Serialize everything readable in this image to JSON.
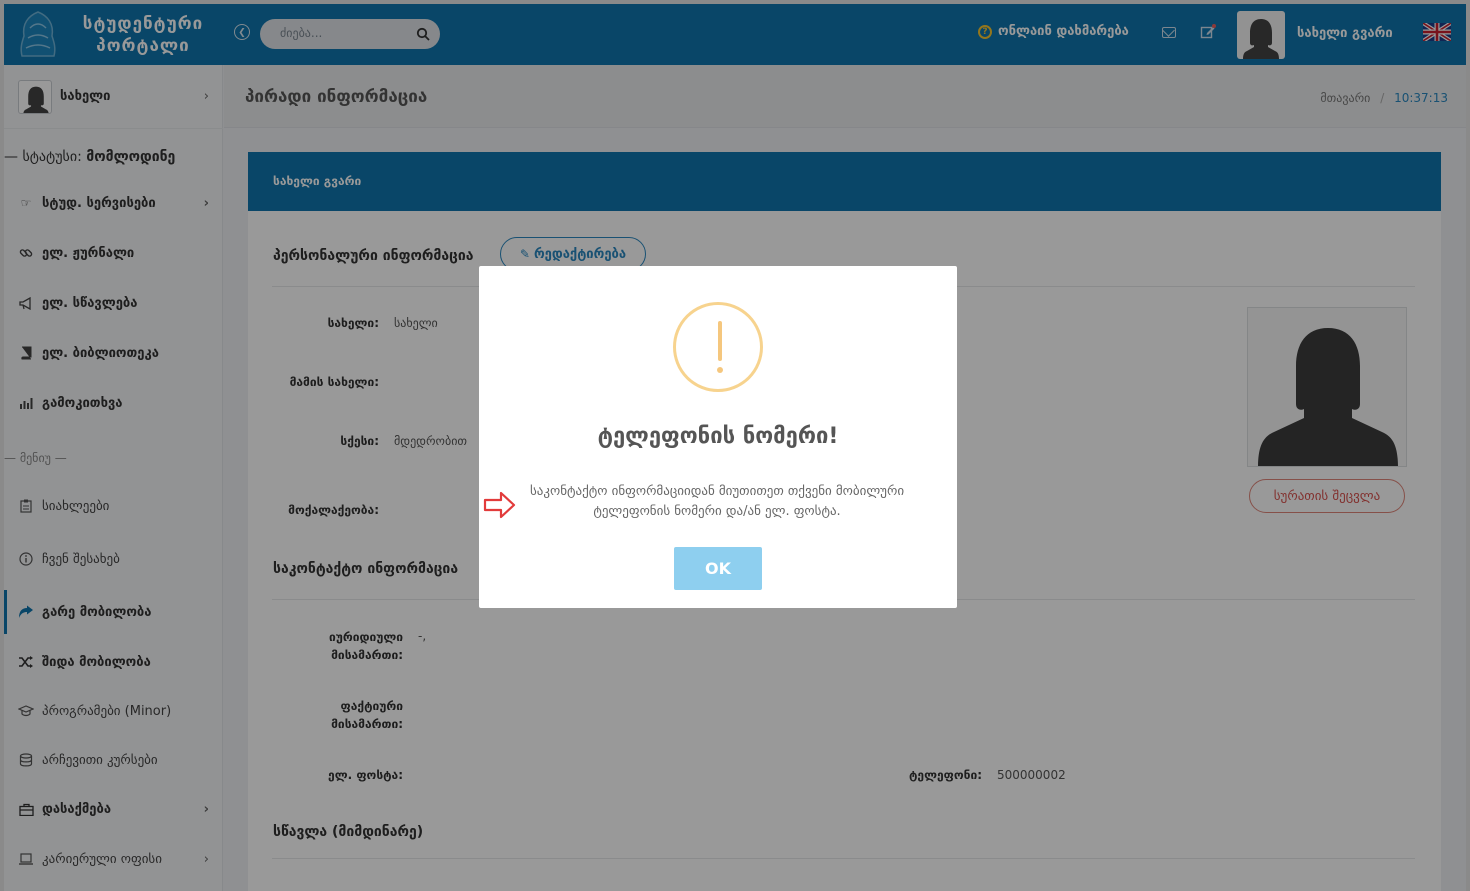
{
  "header": {
    "logo_line1": "სტუდენტური",
    "logo_line2": "პორტალი",
    "search_placeholder": "ძიება...",
    "help_label": "ონლაინ დახმარება",
    "user_name": "სახელი გვარი",
    "colors": {
      "topbar": "#0f76ad",
      "help_icon": "#f5c531"
    }
  },
  "sidebar": {
    "profile_name": "სახელი",
    "status_label": "— სტატუსი:",
    "status_value": "მომლოდინე",
    "menu_separator": "— მენიუ —",
    "items_top": [
      {
        "label": "სტუდ. სერვისები",
        "icon": "hand-point-icon",
        "has_chevron": true
      },
      {
        "label": "ელ. ჟურნალი",
        "icon": "link-icon",
        "has_chevron": false
      },
      {
        "label": "ელ. სწავლება",
        "icon": "megaphone-icon",
        "has_chevron": false
      },
      {
        "label": "ელ. ბიბლიოთეკა",
        "icon": "book-icon",
        "has_chevron": false
      },
      {
        "label": "გამოკითხვა",
        "icon": "bar-chart-icon",
        "has_chevron": false
      }
    ],
    "items_menu": [
      {
        "label": "სიახლეები",
        "icon": "clipboard-icon",
        "has_chevron": false
      },
      {
        "label": "ჩვენ შესახებ",
        "icon": "info-icon",
        "has_chevron": false
      },
      {
        "label": "გარე მობილობა",
        "icon": "share-arrow-icon",
        "has_chevron": false,
        "active": true
      },
      {
        "label": "შიდა მობილობა",
        "icon": "shuffle-icon",
        "has_chevron": false
      },
      {
        "label": "პროგრამები (Minor)",
        "icon": "graduation-cap-icon",
        "has_chevron": false
      },
      {
        "label": "არჩევითი კურსები",
        "icon": "database-icon",
        "has_chevron": false
      },
      {
        "label": "დასაქმება",
        "icon": "briefcase-icon",
        "has_chevron": true
      },
      {
        "label": "კარიერული ოფისი",
        "icon": "laptop-icon",
        "has_chevron": true
      }
    ]
  },
  "page": {
    "title": "პირადი ინფორმაცია",
    "breadcrumb_home": "მთავარი",
    "breadcrumb_sep": "/",
    "time": "10:37:13",
    "card_header": "სახელი გვარი",
    "personal_section": "პერსონალური ინფორმაცია",
    "edit_button": "რედაქტირება",
    "fields": {
      "name_label": "სახელი:",
      "name_value": "სახელი",
      "father_label": "მამის სახელი:",
      "gender_label": "სქესი:",
      "gender_value": "მდედრობით",
      "citizenship_label": "მოქალაქეობა:"
    },
    "contact_section": "საკონტაქტო ინფორმაცია",
    "contact": {
      "legal_address_label": "იურიდიული მისამართი:",
      "legal_address_value": "-,",
      "actual_address_label": "ფაქტიური მისამართი:",
      "email_label": "ელ. ფოსტა:",
      "phone_label": "ტელეფონი:",
      "phone_value": "500000002"
    },
    "education_section": "სწავლა (მიმდინარე)",
    "photo_button": "სურათის შეცვლა"
  },
  "modal": {
    "title": "ტელეფონის ნომერი!",
    "message": "საკონტაქტო ინფორმაციიდან მიუთითეთ თქვენი მობილური ტელეფონის ნომერი და/ან ელ. ფოსტა.",
    "ok_button": "OK",
    "colors": {
      "warning": "#f5c77e",
      "ok": "#8ecfef",
      "arrow": "#e23b3b"
    }
  }
}
